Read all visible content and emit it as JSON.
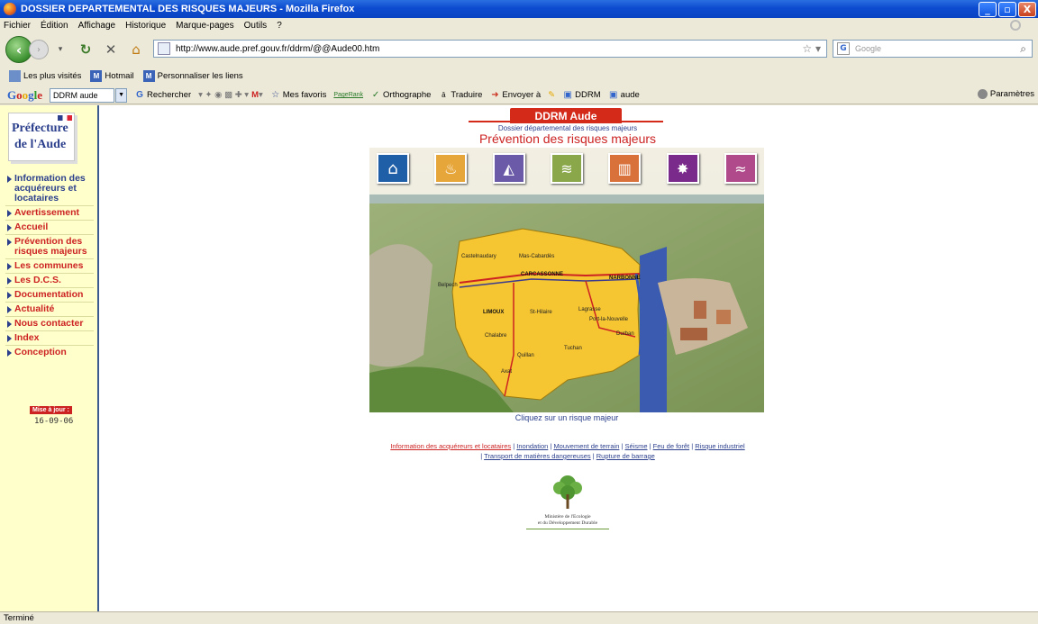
{
  "window": {
    "title": "DOSSIER DEPARTEMENTAL DES RISQUES MAJEURS - Mozilla Firefox",
    "buttons": [
      "_",
      "▫",
      "X"
    ]
  },
  "menu": [
    "Fichier",
    "Édition",
    "Affichage",
    "Historique",
    "Marque-pages",
    "Outils",
    "?"
  ],
  "navbar": {
    "url": "http://www.aude.pref.gouv.fr/ddrm/@@Aude00.htm",
    "search_placeholder": "Google"
  },
  "bookmarks": [
    {
      "label": "Les plus visités",
      "icon": "page-icon"
    },
    {
      "label": "Hotmail",
      "icon": "msn-icon"
    },
    {
      "label": "Personnaliser les liens",
      "icon": "msn-icon"
    }
  ],
  "google_toolbar": {
    "logo": "Google",
    "query": "DDRM aude",
    "items": [
      "Rechercher",
      "Mes favoris",
      "PageRank",
      "Orthographe",
      "Traduire",
      "Envoyer à",
      "DDRM",
      "aude"
    ],
    "params": "Paramètres"
  },
  "sidebar": {
    "logo_line1": "Préfecture",
    "logo_line2": "de l'Aude",
    "items": [
      "Information des\nacquéreurs et\nlocataires",
      "Avertissement",
      "Accueil",
      "Prévention des\nrisques majeurs",
      "Les communes",
      "Les D.C.S.",
      "Documentation",
      "Actualité",
      "Nous contacter",
      "Index",
      "Conception"
    ],
    "update_label": "Mise à jour :",
    "update_date": "16-09-06"
  },
  "main": {
    "banner": "DDRM Aude",
    "subtitle": "Dossier départemental des risques majeurs",
    "title": "Prévention des risques majeurs",
    "risk_icons": [
      "inondation-icon",
      "feu-de-foret-icon",
      "mouvement-de-terrain-icon",
      "seisme-icon",
      "risque-industriel-icon",
      "transport-matieres-dangereuses-icon",
      "rupture-de-barrage-icon"
    ],
    "map_towns": [
      "Castelnaudary",
      "Mas-Cabardès",
      "CARCASSONNE",
      "NARBONNE",
      "Belpech",
      "LIMOUX",
      "St-Hilaire",
      "Lagrasse",
      "Port-la-Nouvelle",
      "Chalabre",
      "Durban",
      "Tuchan",
      "Quillan",
      "Axat"
    ],
    "caption": "Cliquez sur un risque majeur",
    "links_line1": [
      "Information des acquéreurs et locataires",
      "Inondation",
      "Mouvement de terrain",
      "Séisme",
      "Feu de forêt",
      "Risque industriel"
    ],
    "links_line2": [
      "Transport de matières dangereuses",
      "Rupture de barrage"
    ],
    "ministry_line1": "Ministère de l'Ecologie",
    "ministry_line2": "et du Développement Durable"
  },
  "status": "Terminé"
}
